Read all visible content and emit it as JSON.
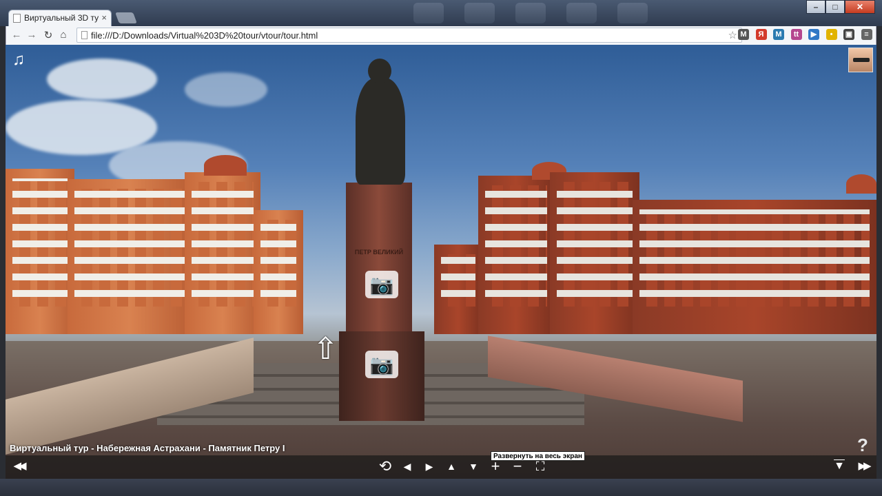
{
  "browser": {
    "tab_title": "Виртуальный 3D ту",
    "tab_close": "×",
    "url": "file:///D:/Downloads/Virtual%203D%20tour/vtour/tour.html",
    "window_buttons": {
      "minimize": "–",
      "maximize": "□",
      "close": "✕"
    },
    "nav_icons": {
      "back": "←",
      "forward": "→",
      "reload": "↻",
      "home": "⌂",
      "bookmark": "☆"
    },
    "extensions": [
      {
        "name": "gmail-icon",
        "glyph": "M",
        "color": "#555555"
      },
      {
        "name": "yandex-icon",
        "glyph": "Я",
        "color": "#d33a2c"
      },
      {
        "name": "m-extension-icon",
        "glyph": "M",
        "color": "#2a7ab0"
      },
      {
        "name": "tt-extension-icon",
        "glyph": "tt",
        "color": "#b5468f"
      },
      {
        "name": "play-extension-icon",
        "glyph": "▶",
        "color": "#3178c6"
      },
      {
        "name": "sticky-extension-icon",
        "glyph": "•",
        "color": "#e1b300"
      },
      {
        "name": "screenshot-extension-icon",
        "glyph": "▣",
        "color": "#444444"
      },
      {
        "name": "menu-icon",
        "glyph": "≡",
        "color": "#666666"
      }
    ]
  },
  "tour": {
    "music_icon": "♫",
    "caption": "Виртуальный тур - Набережная Астрахани - Памятник Петру I",
    "help_icon": "?",
    "tooltip": "Развернуть на весь экран",
    "pedestal_text": "ПЕТР ВЕЛИКИЙ",
    "hotspot_camera": "📷",
    "hotspot_arrow": "⇧",
    "controls": {
      "prev_tour": "◀◀",
      "auto_rotate": "⟲",
      "left": "◀",
      "right": "▶",
      "up": "▲",
      "down": "▼",
      "zoom_in": "+",
      "zoom_out": "−",
      "fullscreen": "⛶",
      "hide_bar": "▼",
      "next_tour": "▶▶"
    }
  }
}
